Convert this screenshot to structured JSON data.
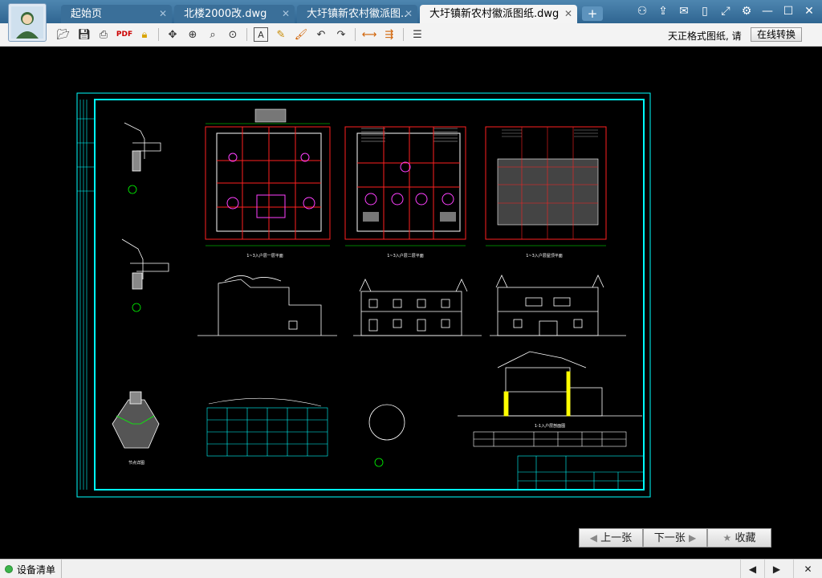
{
  "tabs": [
    {
      "label": "起始页",
      "active": false
    },
    {
      "label": "北楼2000改.dwg",
      "active": false
    },
    {
      "label": "大圩镇新农村徽派图...",
      "active": false
    },
    {
      "label": "大圩镇新农村徽派图纸.dwg",
      "active": true
    }
  ],
  "add_tab_label": "+",
  "toolbar": {
    "notice_text": "天正格式图纸, 请",
    "convert_label": "在线转换"
  },
  "drawing": {
    "plan_titles": [
      "1~3入户层一层平面",
      "1~3入户层二层平面",
      "1~3入户层屋顶平面"
    ],
    "section_title": "1-1入户层剖面图",
    "detail_title": "节点详图",
    "colors": {
      "frame": "#00ffff",
      "red": "#ff2020",
      "magenta": "#ff40ff",
      "yellow": "#ffff00",
      "green": "#00ff00",
      "white": "#ffffff"
    }
  },
  "nav": {
    "prev_label": "上一张",
    "next_label": "下一张",
    "fav_label": "收藏"
  },
  "statusbar": {
    "label": "设备清单"
  }
}
